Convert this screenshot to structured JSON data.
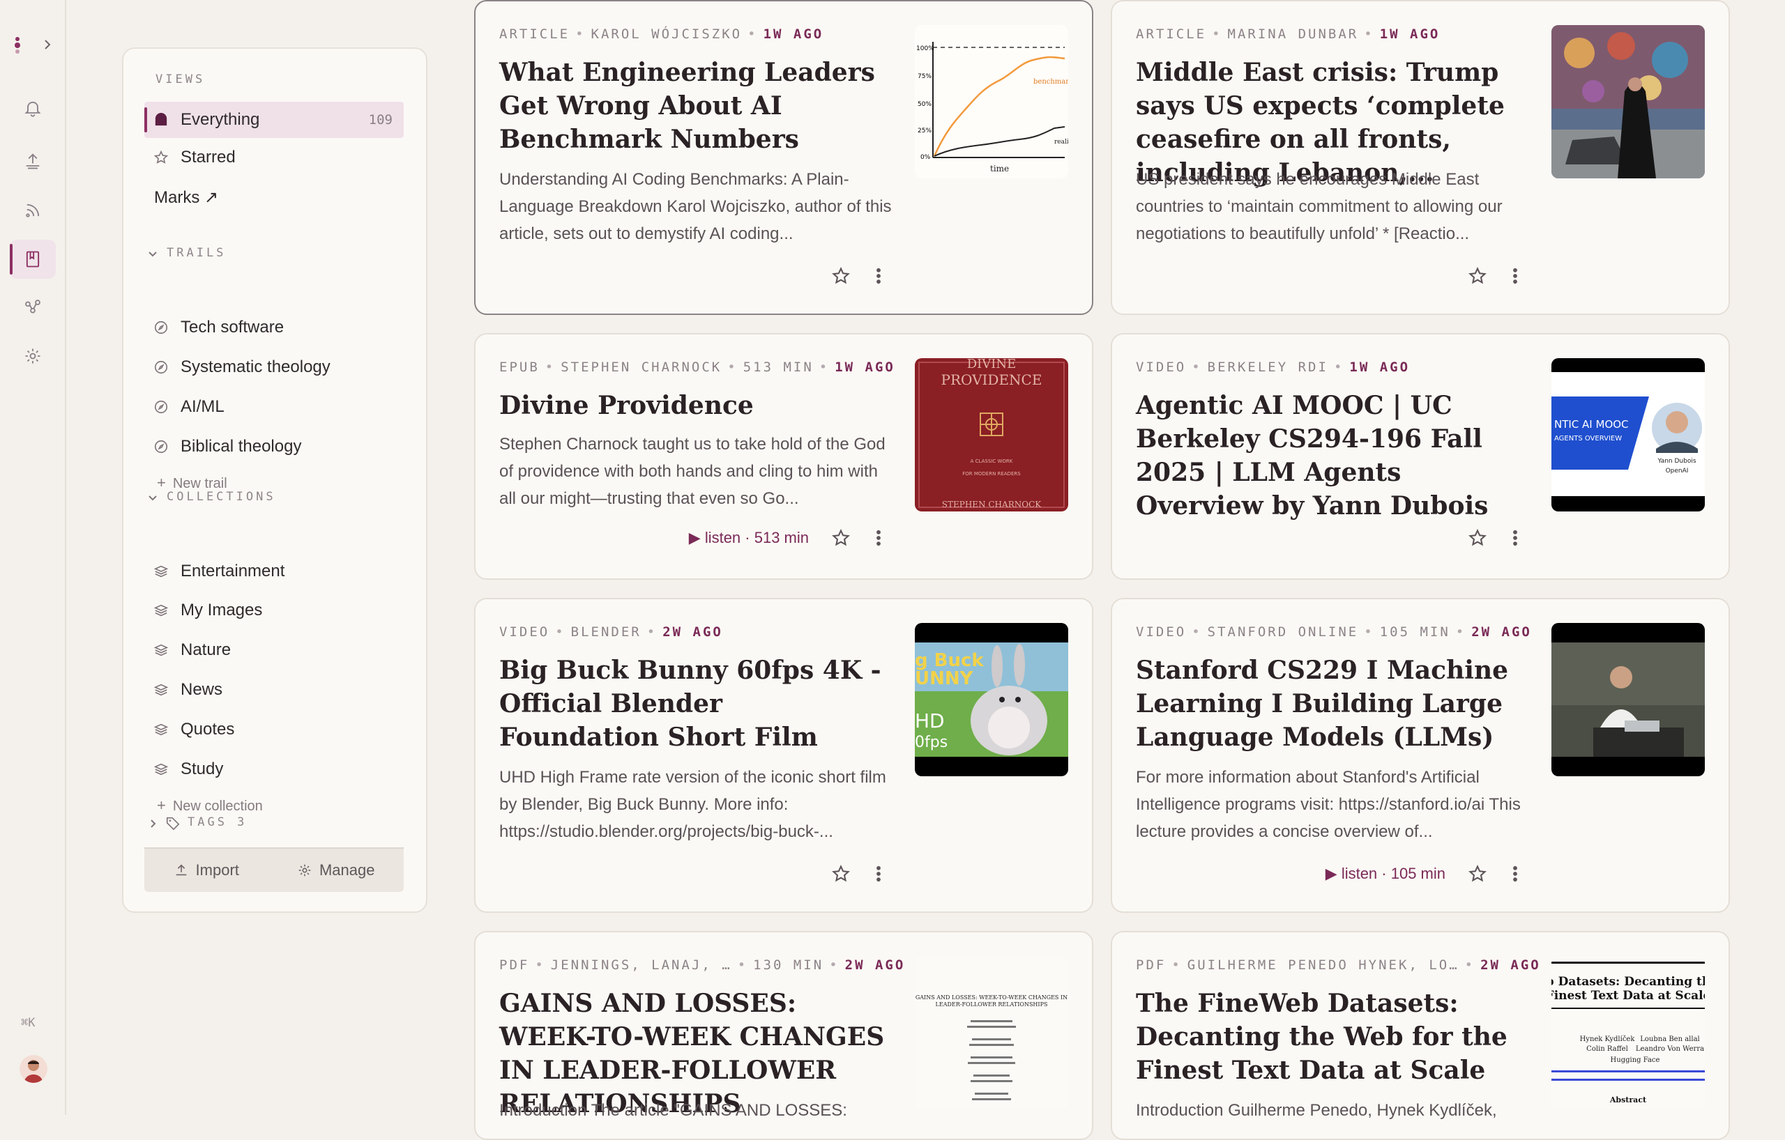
{
  "sidebar": {
    "views_heading": "VIEWS",
    "views": [
      {
        "label": "Everything",
        "count": "109",
        "icon": "inbox-filled-icon"
      },
      {
        "label": "Starred",
        "icon": "star-icon"
      },
      {
        "label": "Marks ↗",
        "icon": ""
      }
    ],
    "trails_heading": "TRAILS",
    "trails": [
      {
        "label": "Tech software"
      },
      {
        "label": "Systematic theology"
      },
      {
        "label": "AI/ML"
      },
      {
        "label": "Biblical theology"
      }
    ],
    "new_trail": "New trail",
    "collections_heading": "COLLECTIONS",
    "collections": [
      {
        "label": "Entertainment"
      },
      {
        "label": "My Images"
      },
      {
        "label": "Nature"
      },
      {
        "label": "News"
      },
      {
        "label": "Quotes"
      },
      {
        "label": "Study"
      }
    ],
    "new_collection": "New collection",
    "tags_heading": "TAGS 3",
    "import_label": "Import",
    "manage_label": "Manage"
  },
  "rail": {
    "shortcut": "⌘K",
    "icons": [
      "bell-icon",
      "upload-icon",
      "rss-icon",
      "library-icon",
      "graph-icon",
      "settings-icon"
    ],
    "accent": "#8c2f63"
  },
  "cards": [
    {
      "type": "ARTICLE",
      "author": "KAROL WÓJCISZKO",
      "ago": "1W AGO",
      "title": "What Engineering Leaders Get Wrong About AI Benchmark Numbers",
      "desc": "Understanding AI Coding Benchmarks: A Plain-Language Breakdown Karol Wojciszko, author of this article, sets out to demystify AI coding...",
      "thumb_labels": {
        "y1": "100%",
        "y2": "75%",
        "y3": "50%",
        "y4": "25%",
        "y5": "0%",
        "series": "benchmark",
        "series2": "reality",
        "xlab": "time"
      }
    },
    {
      "type": "ARTICLE",
      "author": "MARINA DUNBAR",
      "ago": "1W AGO",
      "title": "Middle East crisis: Trump says US expects ‘complete ceasefire on all fronts, including Lebanon,...",
      "desc": "US president says he encourages Middle East countries to ‘maintain commitment to allowing our negotiations to beautifully unfold’ * [Reactio..."
    },
    {
      "type": "EPUB",
      "author": "STEPHEN CHARNOCK",
      "length": "513 MIN",
      "ago": "1W AGO",
      "title": "Divine Providence",
      "desc": "Stephen Charnock taught us to take hold of the God of providence with both hands and cling to him with all our might—trusting that even so Go...",
      "listen": "listen · 513 min",
      "cover": {
        "title1": "DIVINE",
        "title2": "PROVIDENCE",
        "sub1": "A CLASSIC WORK",
        "sub2": "FOR MODERN READERS",
        "author": "STEPHEN CHARNOCK"
      }
    },
    {
      "type": "VIDEO",
      "author": "BERKELEY RDI",
      "ago": "1W AGO",
      "title": "Agentic AI MOOC | UC Berkeley CS294-196 Fall 2025 | LLM Agents Overview by Yann Dubois",
      "thumb_labels": {
        "line1": "NTIC AI MOOC",
        "line2": "AGENTS OVERVIEW",
        "name": "Yann Dubois",
        "org": "OpenAI"
      }
    },
    {
      "type": "VIDEO",
      "author": "BLENDER",
      "ago": "2W AGO",
      "title": "Big Buck Bunny 60fps 4K - Official Blender Foundation Short Film",
      "desc": "UHD High Frame rate version of the iconic short film by Blender, Big Buck Bunny. More info: https://studio.blender.org/projects/big-buck-...",
      "thumb_labels": {
        "a": "g Buck",
        "b": "UNNY",
        "c": "HD",
        "d": "0fps"
      }
    },
    {
      "type": "VIDEO",
      "author": "STANFORD ONLINE",
      "length": "105 MIN",
      "ago": "2W AGO",
      "title": "Stanford CS229 I Machine Learning I Building Large Language Models (LLMs)",
      "desc": "For more information about Stanford's Artificial Intelligence programs visit: https://stanford.io/ai This lecture provides a concise overview of...",
      "listen": "listen · 105 min"
    },
    {
      "type": "PDF",
      "author": "JENNINGS, LANAJ, …",
      "length": "130 MIN",
      "ago": "2W AGO",
      "title": "GAINS AND LOSSES: WEEK-TO-WEEK CHANGES IN LEADER-FOLLOWER RELATIONSHIPS",
      "desc": "Introduction The article \"GAINS AND LOSSES:",
      "thumb_labels": {
        "h1": "GAINS AND LOSSES: WEEK-TO-WEEK CHANGES IN",
        "h2": "LEADER-FOLLOWER RELATIONSHIPS"
      }
    },
    {
      "type": "PDF",
      "author": "GUILHERME PENEDO HYNEK, LO…",
      "ago": "2W AGO",
      "title": "The FineWeb Datasets: Decanting the Web for the Finest Text Data at Scale",
      "desc": "Introduction Guilherme Penedo, Hynek Kydlíček,",
      "thumb_labels": {
        "h1": "eb Datasets: Decanting the",
        "h2": "Finest Text Data at Scale",
        "a1": "Hynek Kydlíček",
        "a2": "Loubna Ben allal",
        "a3": "Colin Raffel",
        "a4": "Leandro Von Werra",
        "hf": "Hugging Face",
        "abs": "Abstract"
      }
    }
  ]
}
